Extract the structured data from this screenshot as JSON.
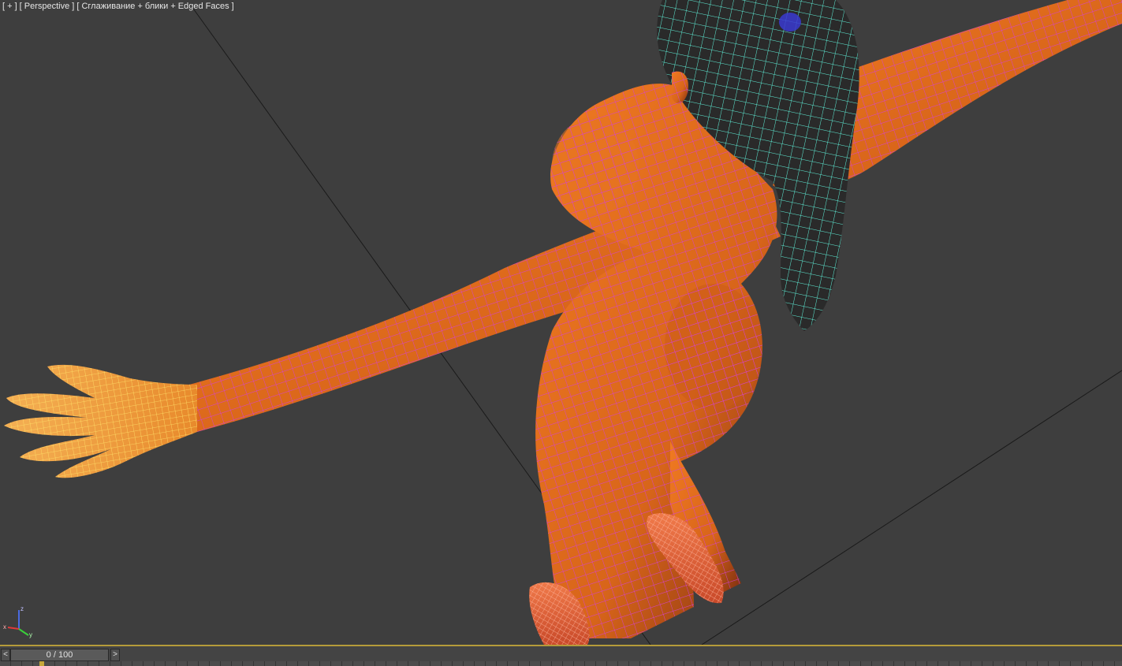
{
  "viewport": {
    "label_parts": [
      "[ + ]",
      "[ Perspective ]",
      "[ Сглаживание + блики + Edged Faces ]"
    ],
    "view": "Perspective",
    "shading": "Сглаживание + блики + Edged Faces"
  },
  "gizmo": {
    "axes": [
      "z",
      "x",
      "y"
    ],
    "colors": {
      "x": "#e03a3a",
      "y": "#3ad03a",
      "z": "#4a6ae0"
    }
  },
  "timeline": {
    "prev_label": "<",
    "next_label": ">",
    "frame_display": "0 / 100",
    "current_frame": 0,
    "total_frames": 100
  },
  "colors": {
    "viewport_bg": "#3e3e3e",
    "body_mesh": "#e0701c",
    "body_wire": "#d43fd8",
    "hand_mesh": "#f2a040",
    "hand_wire": "#ffe46a",
    "foot_mesh": "#e8603a",
    "foot_wire": "#ff9a80",
    "hair_mesh": "#2c2c2c",
    "hair_wire": "#5ff0d8",
    "timeline_accent": "#b59b3a"
  }
}
